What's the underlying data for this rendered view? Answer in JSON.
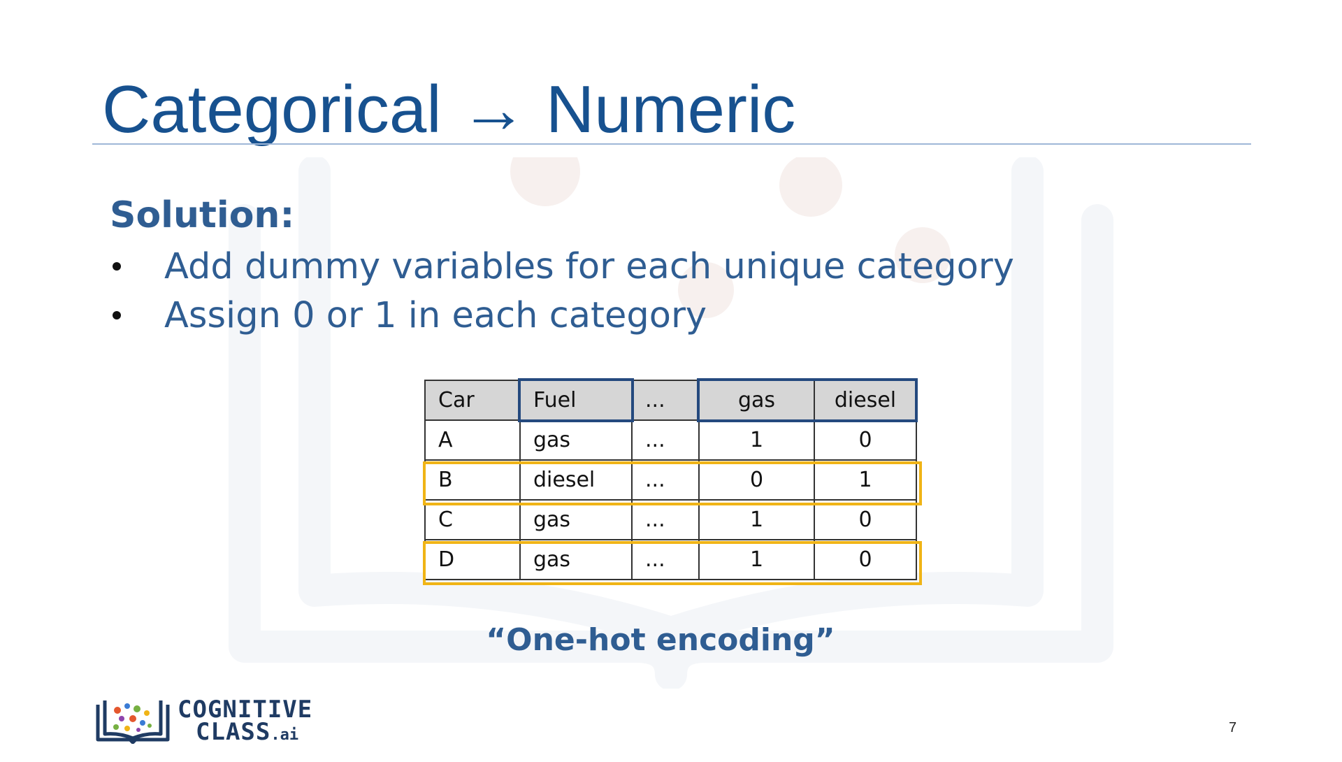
{
  "slide": {
    "title_left": "Categorical",
    "title_arrow": "→",
    "title_right": "Numeric",
    "solution_heading": "Solution:",
    "bullets": [
      "Add dummy variables for each unique category",
      "Assign 0 or 1 in each category"
    ],
    "table": {
      "headers": [
        "Car",
        "Fuel",
        "...",
        "gas",
        "diesel"
      ],
      "rows": [
        [
          "A",
          "gas",
          "...",
          "1",
          "0"
        ],
        [
          "B",
          "diesel",
          "...",
          "0",
          "1"
        ],
        [
          "C",
          "gas",
          "...",
          "1",
          "0"
        ],
        [
          "D",
          "gas",
          "...",
          "1",
          "0"
        ]
      ]
    },
    "caption": "“One-hot encoding”",
    "page_number": "7"
  },
  "logo": {
    "line1": "COGNITIVE",
    "line2": "CLASS",
    "suffix": ".ai"
  },
  "colors": {
    "title": "#17518f",
    "body_text": "#2f5d92",
    "header_highlight": "#24497e",
    "row_highlight": "#f0b416",
    "header_fill": "#d6d6d6"
  }
}
